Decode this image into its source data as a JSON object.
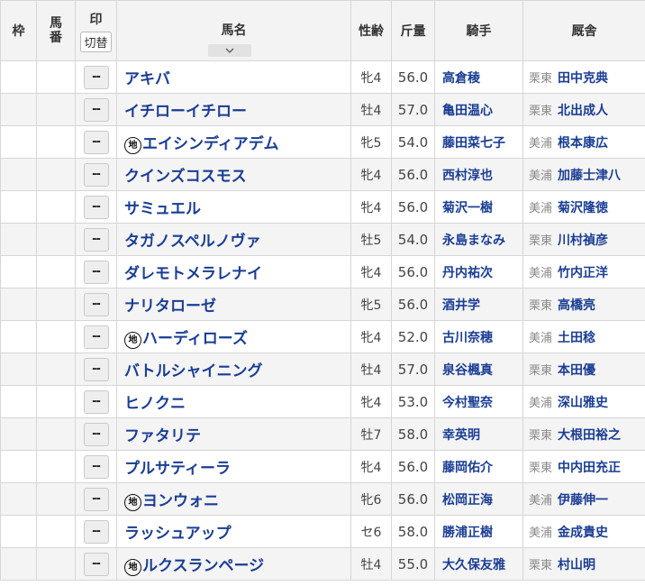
{
  "headers": {
    "waku": "枠",
    "umaban": "馬番",
    "mark": "印",
    "switch": "切替",
    "name": "馬名",
    "sex_age": "性齢",
    "weight": "斤量",
    "jockey": "騎手",
    "stable": "厩舎"
  },
  "chiho_mark": "地",
  "rows": [
    {
      "mark": "--",
      "name": "アキバ",
      "chiho": false,
      "sex_age": "牝4",
      "weight": "56.0",
      "jockey": "高倉稜",
      "region": "栗東",
      "trainer": "田中克典"
    },
    {
      "mark": "--",
      "name": "イチローイチロー",
      "chiho": false,
      "sex_age": "牡4",
      "weight": "57.0",
      "jockey": "亀田温心",
      "region": "栗東",
      "trainer": "北出成人"
    },
    {
      "mark": "--",
      "name": "エイシンディアデム",
      "chiho": true,
      "sex_age": "牝5",
      "weight": "54.0",
      "jockey": "藤田菜七子",
      "region": "美浦",
      "trainer": "根本康広"
    },
    {
      "mark": "--",
      "name": "クインズコスモス",
      "chiho": false,
      "sex_age": "牝4",
      "weight": "56.0",
      "jockey": "西村淳也",
      "region": "美浦",
      "trainer": "加藤士津八"
    },
    {
      "mark": "--",
      "name": "サミュエル",
      "chiho": false,
      "sex_age": "牝4",
      "weight": "56.0",
      "jockey": "菊沢一樹",
      "region": "美浦",
      "trainer": "菊沢隆徳"
    },
    {
      "mark": "--",
      "name": "タガノスペルノヴァ",
      "chiho": false,
      "sex_age": "牡5",
      "weight": "54.0",
      "jockey": "永島まなみ",
      "region": "栗東",
      "trainer": "川村禎彦"
    },
    {
      "mark": "--",
      "name": "ダレモトメラレナイ",
      "chiho": false,
      "sex_age": "牝4",
      "weight": "56.0",
      "jockey": "丹内祐次",
      "region": "美浦",
      "trainer": "竹内正洋"
    },
    {
      "mark": "--",
      "name": "ナリタローゼ",
      "chiho": false,
      "sex_age": "牝5",
      "weight": "56.0",
      "jockey": "酒井学",
      "region": "栗東",
      "trainer": "高橋亮"
    },
    {
      "mark": "--",
      "name": "ハーディローズ",
      "chiho": true,
      "sex_age": "牝4",
      "weight": "52.0",
      "jockey": "古川奈穂",
      "region": "美浦",
      "trainer": "土田稔"
    },
    {
      "mark": "--",
      "name": "バトルシャイニング",
      "chiho": false,
      "sex_age": "牡4",
      "weight": "57.0",
      "jockey": "泉谷楓真",
      "region": "栗東",
      "trainer": "本田優"
    },
    {
      "mark": "--",
      "name": "ヒノクニ",
      "chiho": false,
      "sex_age": "牝4",
      "weight": "53.0",
      "jockey": "今村聖奈",
      "region": "美浦",
      "trainer": "深山雅史"
    },
    {
      "mark": "--",
      "name": "ファタリテ",
      "chiho": false,
      "sex_age": "牡7",
      "weight": "58.0",
      "jockey": "幸英明",
      "region": "栗東",
      "trainer": "大根田裕之"
    },
    {
      "mark": "--",
      "name": "プルサティーラ",
      "chiho": false,
      "sex_age": "牝4",
      "weight": "56.0",
      "jockey": "藤岡佑介",
      "region": "栗東",
      "trainer": "中内田充正"
    },
    {
      "mark": "--",
      "name": "ヨンウォニ",
      "chiho": true,
      "sex_age": "牝6",
      "weight": "56.0",
      "jockey": "松岡正海",
      "region": "美浦",
      "trainer": "伊藤伸一"
    },
    {
      "mark": "--",
      "name": "ラッシュアップ",
      "chiho": false,
      "sex_age": "セ6",
      "weight": "58.0",
      "jockey": "勝浦正樹",
      "region": "美浦",
      "trainer": "金成貴史"
    },
    {
      "mark": "--",
      "name": "ルクスランページ",
      "chiho": true,
      "sex_age": "牡4",
      "weight": "55.0",
      "jockey": "大久保友雅",
      "region": "栗東",
      "trainer": "村山明"
    }
  ]
}
